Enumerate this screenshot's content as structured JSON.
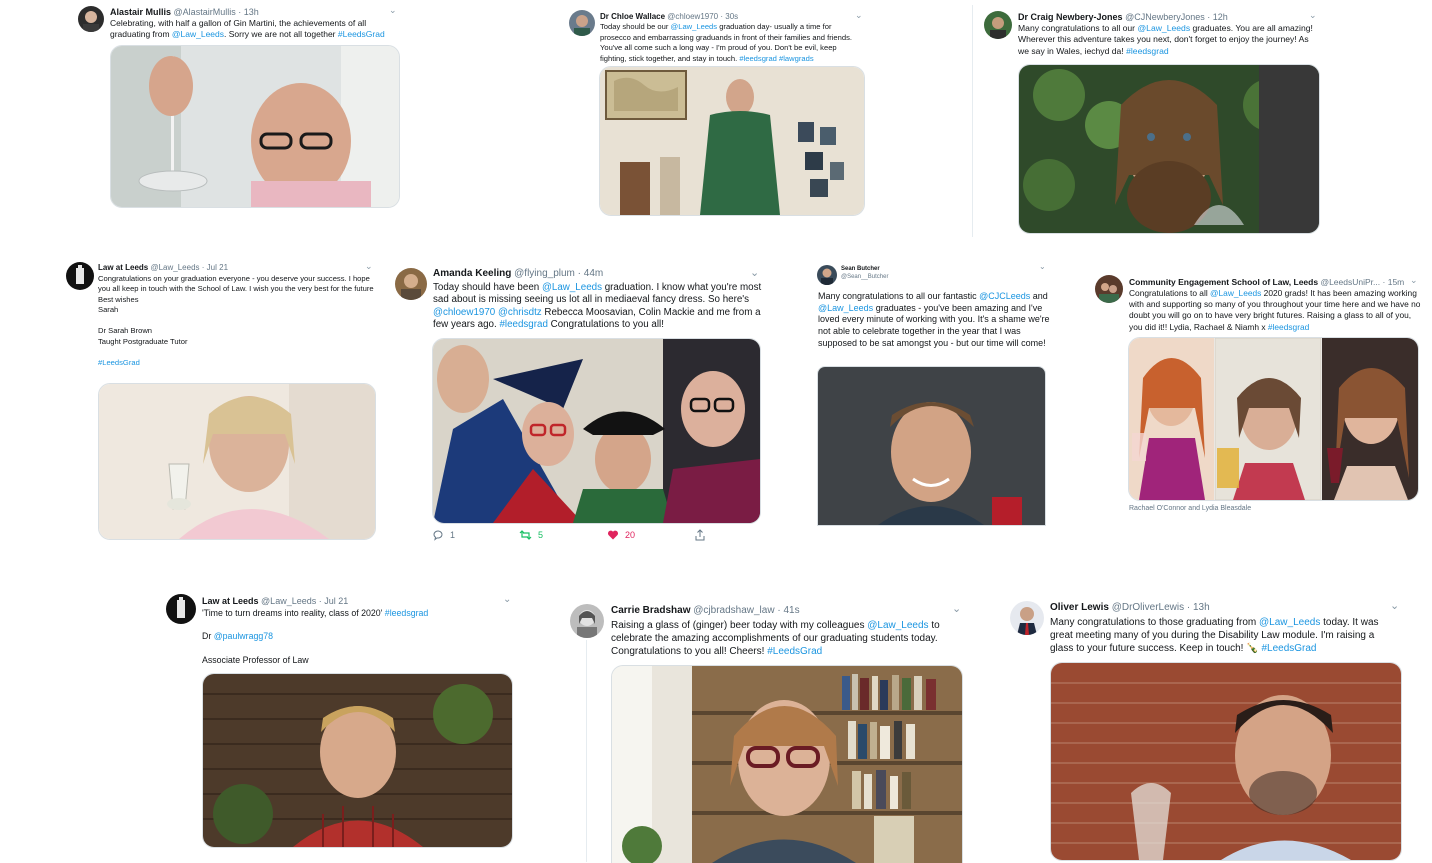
{
  "tweets": [
    {
      "name": "Alastair Mullis",
      "handle": "@AlastairMullis",
      "time": "13h",
      "segments": [
        {
          "t": "Celebrating, with half a gallon of Gin Martini, the achievements of all graduating from "
        },
        {
          "t": "@Law_Leeds",
          "link": true
        },
        {
          "t": ". Sorry we are not all together  "
        },
        {
          "t": "#LeedsGrad",
          "link": true
        }
      ]
    },
    {
      "name": "Dr Chloe Wallace",
      "handle": "@chloew1970",
      "time": "30s",
      "segments": [
        {
          "t": "Today should be our "
        },
        {
          "t": "@Law_Leeds",
          "link": true
        },
        {
          "t": " graduation day- usually a time for prosecco and embarrassing graduands in front of their families and friends. You've all come such a long way - I'm proud of you. Don't be evil, keep fighting, stick together, and stay in touch. "
        },
        {
          "t": "#leedsgrad",
          "link": true
        },
        {
          "t": " "
        },
        {
          "t": "#lawgrads",
          "link": true
        }
      ]
    },
    {
      "name": "Dr Craig Newbery-Jones",
      "handle": "@CJNewberyJones",
      "time": "12h",
      "segments": [
        {
          "t": "Many congratulations to all our "
        },
        {
          "t": "@Law_Leeds",
          "link": true
        },
        {
          "t": " graduates. You are all amazing! Wherever this adventure takes you next, don't forget to enjoy the journey! As we say in Wales, iechyd da! "
        },
        {
          "t": "#leedsgrad",
          "link": true
        }
      ]
    },
    {
      "name": "Law at Leeds",
      "handle": "@Law_Leeds",
      "time": "Jul 21",
      "segments": [
        {
          "t": "Congratulations on your graduation everyone - you deserve your success. I hope you all keep in touch with the School of Law.  I wish you the very best for the future\nBest wishes\nSarah\n\nDr Sarah Brown\nTaught Postgraduate Tutor\n\n"
        },
        {
          "t": "#LeedsGrad",
          "link": true
        }
      ]
    },
    {
      "name": "Amanda Keeling",
      "handle": "@flying_plum",
      "time": "44m",
      "segments": [
        {
          "t": "Today should have been "
        },
        {
          "t": "@Law_Leeds",
          "link": true
        },
        {
          "t": " graduation. I know what you're most sad about is missing seeing us lot all in mediaeval fancy dress. So here's "
        },
        {
          "t": "@chloew1970",
          "link": true
        },
        {
          "t": " "
        },
        {
          "t": "@chrisdtz",
          "link": true
        },
        {
          "t": " Rebecca Moosavian, Colin Mackie and me from a few years ago. "
        },
        {
          "t": "#leedsgrad",
          "link": true
        },
        {
          "t": " Congratulations to you all!"
        }
      ],
      "actions": {
        "replies": "1",
        "retweets": "5",
        "likes": "20"
      }
    },
    {
      "name": "Sean Butcher",
      "handle": "@Sean__Butcher",
      "time": "",
      "segments": [
        {
          "t": "Many congratulations to all our fantastic "
        },
        {
          "t": "@CJCLeeds",
          "link": true
        },
        {
          "t": " and "
        },
        {
          "t": "@Law_Leeds",
          "link": true
        },
        {
          "t": " graduates - you've been amazing and I've loved every minute of working with you. It's a shame we're not able to celebrate together in the year that I was supposed to be sat amongst you - but our time will come!"
        }
      ]
    },
    {
      "name": "Community Engagement School of Law, Leeds",
      "handle": "@LeedsUniPr...",
      "time": "15m",
      "segments": [
        {
          "t": "Congratulations to all "
        },
        {
          "t": "@Law_Leeds",
          "link": true
        },
        {
          "t": " 2020 grads! It has been amazing working with and supporting so many of you throughout your time here and we have no doubt you will go on to have very bright futures. Raising a glass to all of you, you did it!! Lydia, Rachael & Niamh x "
        },
        {
          "t": "#leedsgrad",
          "link": true
        }
      ],
      "caption": "Rachael O'Connor and Lydia Bleasdale"
    },
    {
      "name": "Law at Leeds",
      "handle": "@Law_Leeds",
      "time": "Jul 21",
      "segments": [
        {
          "t": "'Time to turn dreams into reality, class of 2020' "
        },
        {
          "t": "#leedsgrad",
          "link": true
        },
        {
          "t": "\n\nDr "
        },
        {
          "t": "@paulwragg78",
          "link": true
        },
        {
          "t": "\n\nAssociate Professor of Law"
        }
      ]
    },
    {
      "name": "Carrie Bradshaw",
      "handle": "@cjbradshaw_law",
      "time": "41s",
      "segments": [
        {
          "t": "Raising a glass of (ginger) beer today with my colleagues "
        },
        {
          "t": "@Law_Leeds",
          "link": true
        },
        {
          "t": " to celebrate the amazing accomplishments of our graduating students today. Congratulations to you all! Cheers!  "
        },
        {
          "t": "#LeedsGrad",
          "link": true
        }
      ]
    },
    {
      "name": "Oliver Lewis",
      "handle": "@DrOliverLewis",
      "time": "13h",
      "segments": [
        {
          "t": "Many congratulations to those graduating from "
        },
        {
          "t": "@Law_Leeds",
          "link": true
        },
        {
          "t": " today. It was great meeting many of you during the Disability Law module. I'm raising a glass to your future success. Keep in touch! 🍾 "
        },
        {
          "t": "#LeedsGrad",
          "link": true
        }
      ]
    }
  ],
  "colors": {
    "link": "#1b95e0",
    "muted": "#657786",
    "retweet": "#17bf63",
    "like": "#e0245e"
  },
  "icons": {
    "more": "chevron-down-icon",
    "reply": "reply-icon",
    "retweet": "retweet-icon",
    "like": "heart-icon",
    "share": "share-icon"
  }
}
